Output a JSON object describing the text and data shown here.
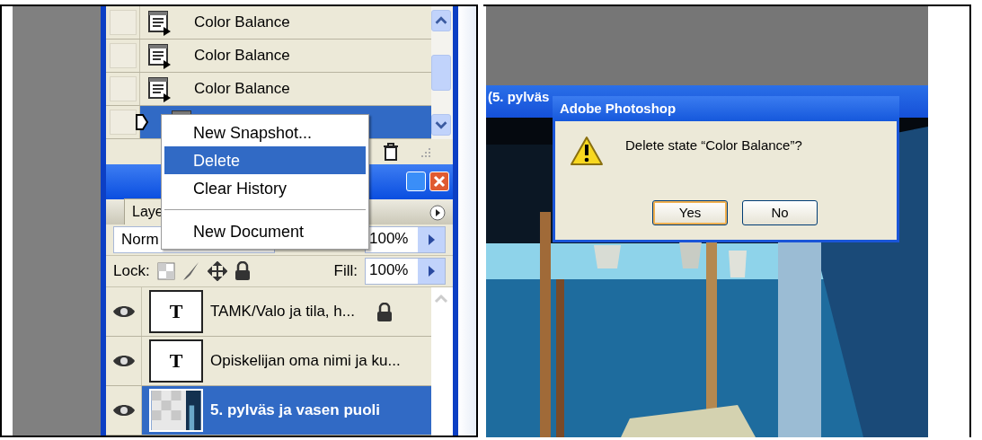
{
  "history": {
    "items": [
      {
        "label": "Color Balance",
        "snapshot": false,
        "selected": false
      },
      {
        "label": "Color Balance",
        "snapshot": false,
        "selected": false
      },
      {
        "label": "Color Balance",
        "snapshot": false,
        "selected": false
      },
      {
        "snapshot": false,
        "selected": true
      }
    ]
  },
  "context_menu": {
    "items": [
      {
        "kind": "item",
        "label": "New Snapshot...",
        "selected": false
      },
      {
        "kind": "item",
        "label": "Delete",
        "selected": true
      },
      {
        "kind": "item",
        "label": "Clear History",
        "selected": false
      },
      {
        "kind": "separator"
      },
      {
        "kind": "item",
        "label": "New Document",
        "selected": false
      }
    ]
  },
  "layers_panel": {
    "tabs": [
      {
        "label": "Laye",
        "selected": true
      }
    ],
    "blend_mode": "Norm",
    "opacity": "100%",
    "lock_label": "Lock:",
    "fill_label": "Fill:",
    "fill": "100%",
    "layers": [
      {
        "kind": "text",
        "thumbnail_text": "T",
        "name": "TAMK/Valo ja tila, h...",
        "visible": true,
        "locked": true,
        "selected": false
      },
      {
        "kind": "text",
        "thumbnail_text": "T",
        "name": "Opiskelijan oma nimi ja ku...",
        "visible": true,
        "locked": false,
        "selected": false
      },
      {
        "name": "5. pylväs ja vasen puoli",
        "visible": true,
        "locked": false,
        "selected": true
      }
    ]
  },
  "document": {
    "title": "(5. pylväs"
  },
  "dialog": {
    "title": "Adobe Photoshop",
    "message": "Delete state “Color Balance”?",
    "buttons": [
      {
        "label": "Yes",
        "focused": true
      },
      {
        "label": "No",
        "focused": false
      }
    ]
  }
}
